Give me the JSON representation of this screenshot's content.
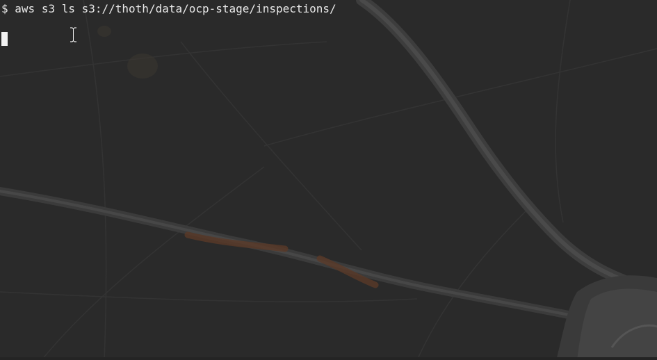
{
  "terminal": {
    "prompt": "$",
    "command": "aws s3 ls s3://thoth/data/ocp-stage/inspections/"
  },
  "icons": {
    "pointer": "text-cursor-ibeam-icon",
    "caret": "terminal-block-cursor"
  },
  "colors": {
    "background": "#2a2a2a",
    "text": "#e8e8e8",
    "cursor": "#f2f2f2"
  }
}
